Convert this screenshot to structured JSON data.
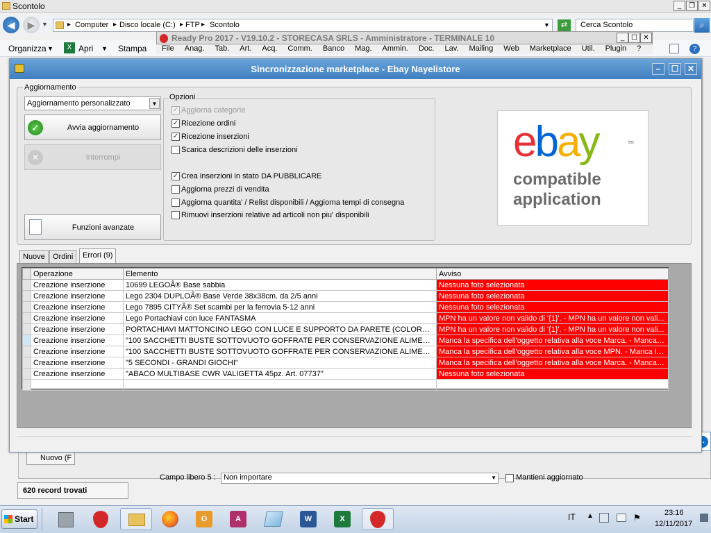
{
  "explorer": {
    "title": "Scontolo",
    "breadcrumb": [
      "Computer",
      "Disco locale (C:)",
      "FTP",
      "Scontolo"
    ],
    "search_placeholder": "Cerca Scontolo",
    "toolbar": {
      "organize": "Organizza",
      "open": "Apri",
      "print": "Stampa"
    }
  },
  "readypro": {
    "title": "Ready Pro 2017 - V19.10.2 - STORECASA SRLS - Amministratore - TERMINALE 10",
    "menu": [
      "File",
      "Anag.",
      "Tab.",
      "Art.",
      "Acq.",
      "Comm.",
      "Banco",
      "Mag.",
      "Ammin.",
      "Doc.",
      "Lav.",
      "Mailing",
      "Web",
      "Marketplace",
      "Util.",
      "Plugin",
      "?"
    ]
  },
  "dialog": {
    "title": "Sincronizzazione marketplace - Ebay Nayelistore",
    "group_update": "Aggiornamento",
    "update_mode": "Aggiornamento personalizzato",
    "start_button": "Avvia aggiornamento",
    "stop_button": "Interrompi",
    "advanced_button": "Funzioni avanzate",
    "options_title": "Opzioni",
    "options": [
      {
        "label": "Aggiorna categorie",
        "checked": true,
        "disabled": true
      },
      {
        "label": "Ricezione ordini",
        "checked": true,
        "disabled": false
      },
      {
        "label": "Ricezione inserzioni",
        "checked": true,
        "disabled": false
      },
      {
        "label": "Scarica descrizioni delle inserzioni",
        "checked": false,
        "disabled": false
      },
      {
        "label": "Crea inserzioni in stato DA PUBBLICARE",
        "checked": true,
        "disabled": false
      },
      {
        "label": "Aggiorna prezzi di vendita",
        "checked": false,
        "disabled": false
      },
      {
        "label": "Aggiorna quantita' / Relist disponibili / Aggiorna tempi di consegna",
        "checked": false,
        "disabled": false
      },
      {
        "label": "Rimuovi inserzioni relative ad articoli non piu' disponibili",
        "checked": false,
        "disabled": false
      }
    ],
    "logo": {
      "brand": "ebay",
      "tm": "tm",
      "line1": "compatible",
      "line2": "application",
      "colors": [
        "#e53238",
        "#0064d2",
        "#f5af02",
        "#86b817"
      ]
    },
    "tabs": [
      "Nuove",
      "Ordini",
      "Errori (9)"
    ],
    "active_tab": 2,
    "columns": [
      "Operazione",
      "Elemento",
      "Avviso"
    ],
    "rows": [
      {
        "op": "Creazione inserzione",
        "el": "10699 LEGOÂ® Base sabbia",
        "warn": "Nessuna foto selezionata"
      },
      {
        "op": "Creazione inserzione",
        "el": "Lego 2304 DUPLOÂ® Base Verde 38x38cm. da 2/5 anni",
        "warn": "Nessuna foto selezionata"
      },
      {
        "op": "Creazione inserzione",
        "el": "Lego 7895 CITYÂ® Set scambi per la ferrovia 5-12 anni",
        "warn": "Nessuna foto selezionata"
      },
      {
        "op": "Creazione inserzione",
        "el": "Lego Portachiavi con luce FANTASMA",
        "warn": "MPN ha un valore non valido di '{1}'. - MPN ha un valore non vali..."
      },
      {
        "op": "Creazione inserzione",
        "el": "PORTACHIAVI MATTONCINO LEGO CON LUCE E SUPPORTO DA PARETE (COLORE CASUA...",
        "warn": "MPN ha un valore non valido di '{1}'. - MPN ha un valore non vali..."
      },
      {
        "op": "Creazione inserzione",
        "el": "\"100 SACCHETTI BUSTE SOTTOVUOTO GOFFRATE PER CONSERVAZIONE ALIMENTI 20 X ...",
        "warn": "Manca la specifica dell'oggetto relativa alla voce Marca. - Manca l...",
        "current": true
      },
      {
        "op": "Creazione inserzione",
        "el": "\"100 SACCHETTI BUSTE SOTTOVUOTO GOFFRATE PER CONSERVAZIONE ALIMENTI 20 X ...",
        "warn": "Manca la specifica dell'oggetto relativa alla voce MPN. - Manca la ..."
      },
      {
        "op": "Creazione inserzione",
        "el": "\"5 SECONDI - GRANDI GIOCHI\"",
        "warn": "Manca la specifica dell'oggetto relativa alla voce Marca. - Manca l..."
      },
      {
        "op": "Creazione inserzione",
        "el": "\"ABACO MULTIBASE CWR VALIGETTA 45pz. Art. 07737\"",
        "warn": "Nessuna foto selezionata"
      }
    ]
  },
  "background": {
    "new_button": "Nuovo (F",
    "record_count": "620 record trovati",
    "field_label": "Campo libero 5 :",
    "field_value": "Non importare",
    "keep_updated": "Mantieni aggiornato"
  },
  "taskbar": {
    "start": "Start",
    "lang": "IT",
    "time": "23:16",
    "date": "12/11/2017"
  }
}
